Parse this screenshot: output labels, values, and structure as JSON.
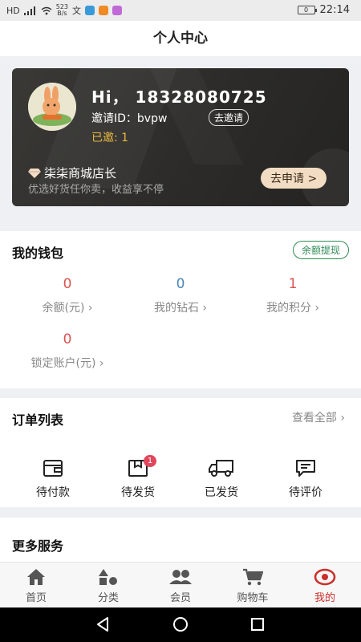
{
  "status_bar": {
    "left_label": "HD",
    "net_speed_value": "523",
    "net_speed_unit": "B/s",
    "battery": "0",
    "time": "22:14",
    "icons": [
      "signal-icon",
      "wifi-icon",
      "translate-icon",
      "app-icon-blue",
      "app-icon-orange",
      "app-icon-purple"
    ]
  },
  "header": {
    "title": "个人中心"
  },
  "profile": {
    "greeting": "Hi，  18328080725",
    "invite_id": "邀请ID：bvpw",
    "invite_button": "去邀请",
    "invited_count": "已邀: 1",
    "shop_title": "柒柒商城店长",
    "shop_subtitle": "优选好货任你卖，收益享不停",
    "apply_button": "去申请 >",
    "avatar": "rabbit-avatar"
  },
  "wallet": {
    "title": "我的钱包",
    "withdraw_button": "余额提现",
    "stats": [
      {
        "value": "0",
        "label": "余额(元) ›",
        "color": "#d9534f"
      },
      {
        "value": "0",
        "label": "我的钻石 ›",
        "color": "#4a86b8"
      },
      {
        "value": "1",
        "label": "我的积分 ›",
        "color": "#d9534f"
      },
      {
        "value": "0",
        "label": "锁定账户(元) ›",
        "color": "#d9534f"
      }
    ]
  },
  "orders": {
    "title": "订单列表",
    "view_all": "查看全部 ›",
    "items": [
      {
        "label": "待付款",
        "icon": "wallet-icon",
        "badge": ""
      },
      {
        "label": "待发货",
        "icon": "package-icon",
        "badge": "1"
      },
      {
        "label": "已发货",
        "icon": "truck-icon",
        "badge": ""
      },
      {
        "label": "待评价",
        "icon": "comment-icon",
        "badge": ""
      }
    ]
  },
  "more": {
    "title": "更多服务"
  },
  "tabbar": {
    "active_color": "#c9302c",
    "items": [
      {
        "label": "首页",
        "icon": "home-icon"
      },
      {
        "label": "分类",
        "icon": "category-icon"
      },
      {
        "label": "会员",
        "icon": "members-icon"
      },
      {
        "label": "购物车",
        "icon": "cart-icon"
      },
      {
        "label": "我的",
        "icon": "profile-icon"
      }
    ]
  },
  "navbar": {
    "icons": [
      "back-icon",
      "home-circle-icon",
      "recents-icon"
    ]
  }
}
